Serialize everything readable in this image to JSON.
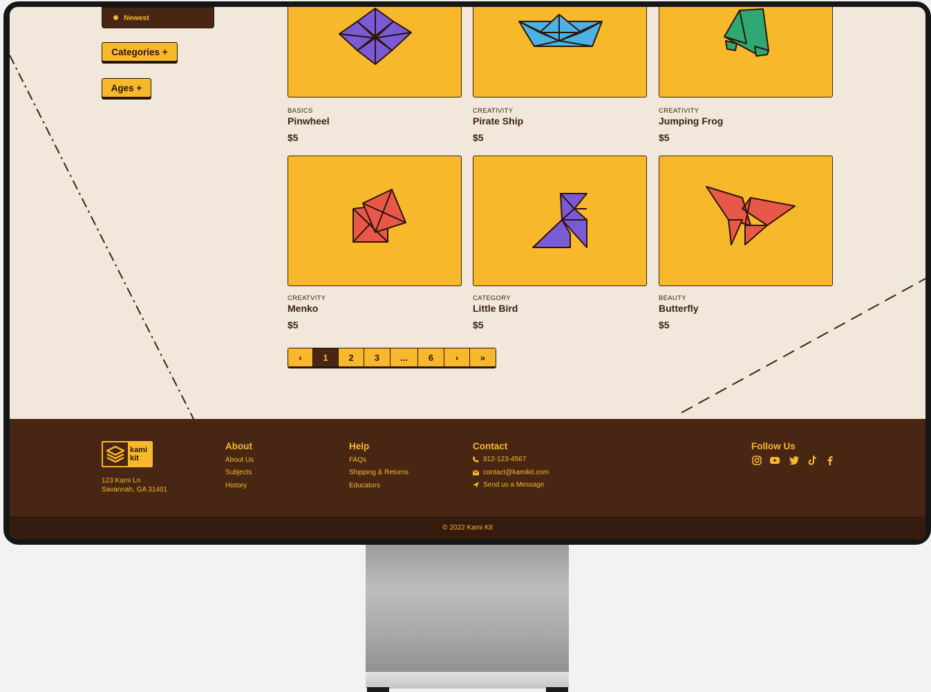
{
  "sidebar": {
    "sort_selected": "Newest",
    "categories_label": "Categories +",
    "ages_label": "Ages +"
  },
  "products": [
    {
      "category": "BASICS",
      "name": "Pinwheel",
      "price": "$5"
    },
    {
      "category": "CREATIVITY",
      "name": "Pirate Ship",
      "price": "$5"
    },
    {
      "category": "CREATIVITY",
      "name": "Jumping Frog",
      "price": "$5"
    },
    {
      "category": "CREATVITY",
      "name": "Menko",
      "price": "$5"
    },
    {
      "category": "CATEGORY",
      "name": "Little Bird",
      "price": "$5"
    },
    {
      "category": "BEAUTY",
      "name": "Butterfly",
      "price": "$5"
    }
  ],
  "pagination": {
    "prev": "‹",
    "pages": [
      "1",
      "2",
      "3",
      "...",
      "6"
    ],
    "current": "1",
    "next": "›",
    "last": "»"
  },
  "footer": {
    "logo_text_line1": "kami",
    "logo_text_line2": "kit",
    "address_line1": "123 Kami Ln",
    "address_line2": "Savannah, GA 31401",
    "about": {
      "heading": "About",
      "links": [
        "About Us",
        "Subjects",
        "History"
      ]
    },
    "help": {
      "heading": "Help",
      "links": [
        "FAQs",
        "Shipping & Returns",
        "Educators"
      ]
    },
    "contact": {
      "heading": "Contact",
      "phone": "912-123-4567",
      "email": "contact@kamikit.com",
      "message": "Send us a Message"
    },
    "follow": {
      "heading": "Follow Us",
      "icons": [
        "instagram-icon",
        "youtube-icon",
        "twitter-icon",
        "tiktok-icon",
        "facebook-icon"
      ]
    },
    "copyright": "© 2022 Kami Kit"
  },
  "colors": {
    "background": "#f1e7da",
    "accent": "#f8b82c",
    "dark_brown": "#472613",
    "pinwheel": "#7b5ad6",
    "ship": "#4ab3e4",
    "frog": "#2fa874",
    "red": "#e8584a"
  }
}
